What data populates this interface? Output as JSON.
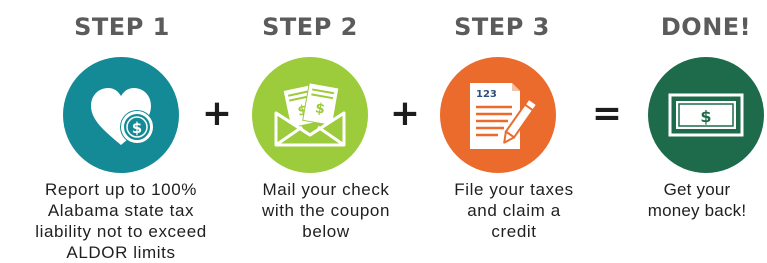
{
  "steps": [
    {
      "heading": "STEP 1",
      "icon": "heart-coin-icon",
      "color": "#148a96",
      "description": "Report up to 100%\nAlabama state tax\nliability not to exceed\nALDOR limits"
    },
    {
      "heading": "STEP 2",
      "icon": "envelope-money-icon",
      "color": "#9ccb3b",
      "description": "Mail your check\nwith the coupon\nbelow"
    },
    {
      "heading": "STEP 3",
      "icon": "tax-form-pen-icon",
      "color": "#eb6b2d",
      "form_number": "123",
      "description": "File your taxes\nand claim a\ncredit"
    }
  ],
  "done": {
    "heading": "DONE!",
    "icon": "dollar-bill-icon",
    "color": "#1e6b4c",
    "bill_symbol": "$",
    "description": "Get your\nmoney back!"
  },
  "operators": {
    "plus": "+",
    "equals": "="
  },
  "colors": {
    "heading_text": "#5b5b5b",
    "body_text": "#1f1f1f"
  }
}
